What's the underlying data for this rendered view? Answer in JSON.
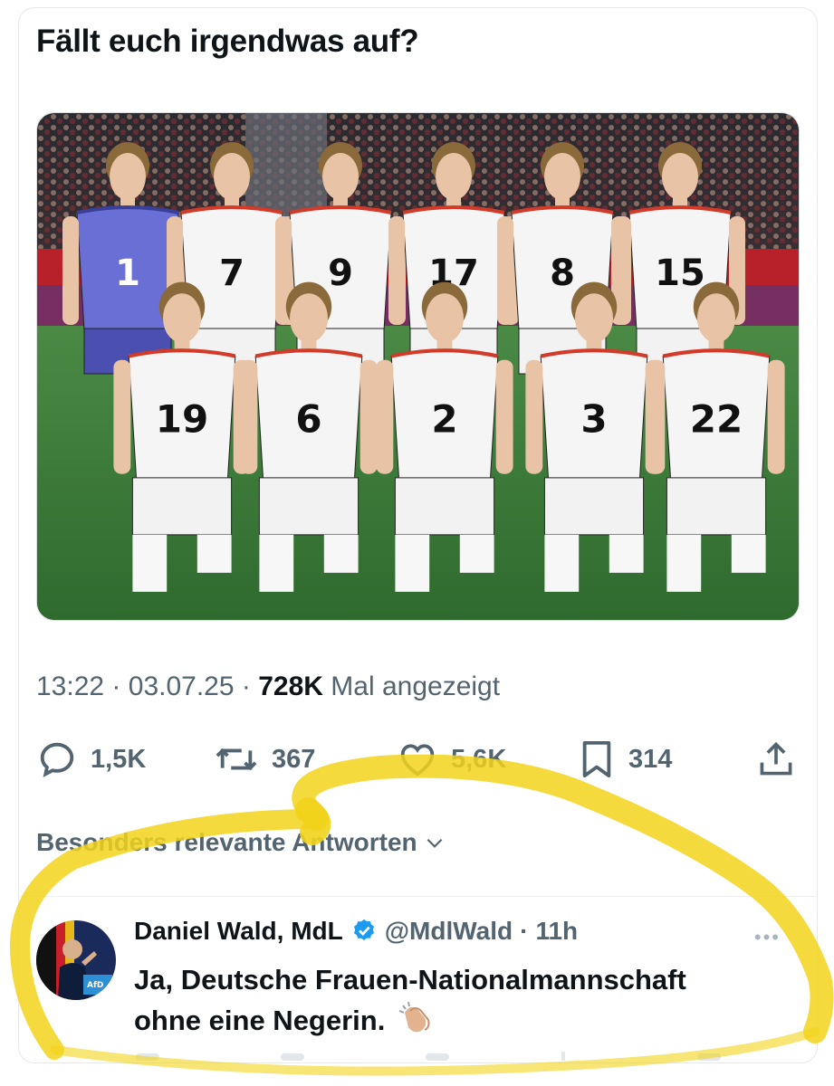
{
  "tweet": {
    "text": "Fällt euch irgendwas auf?",
    "time": "13:22",
    "sep1": "·",
    "date": "03.07.25",
    "sep2": "·",
    "views": "728K",
    "views_label": "Mal angezeigt"
  },
  "actions": {
    "replies": "1,5K",
    "reposts": "367",
    "likes": "5,6K",
    "bookmarks": "314"
  },
  "icons": {
    "reply": "reply-icon",
    "repost": "repost-icon",
    "like": "heart-icon",
    "bookmark": "bookmark-icon",
    "share": "share-icon",
    "verified": "verified-badge-icon",
    "more": "more-icon"
  },
  "sort_label": "Besonders relevante Antworten",
  "reply": {
    "name": "Daniel Wald, MdL",
    "handle": "@MdlWald",
    "sep": "·",
    "age": "11h",
    "text_line1": "Ja, Deutsche Frauen-Nationalmannschaft",
    "text_line2": "ohne eine Negerin.",
    "emoji": "clapping-hands-emoji"
  },
  "jersey_numbers": {
    "back_row": [
      "1",
      "7",
      "9",
      "17",
      "8",
      "15"
    ],
    "front_row": [
      "19",
      "6",
      "2",
      "3",
      "22"
    ]
  },
  "colors": {
    "text_primary": "#0f1419",
    "text_secondary": "#536471",
    "verified_blue": "#1d9bf0",
    "highlight_yellow": "#f2d31b",
    "pitch_green": "#3f7d3a"
  }
}
